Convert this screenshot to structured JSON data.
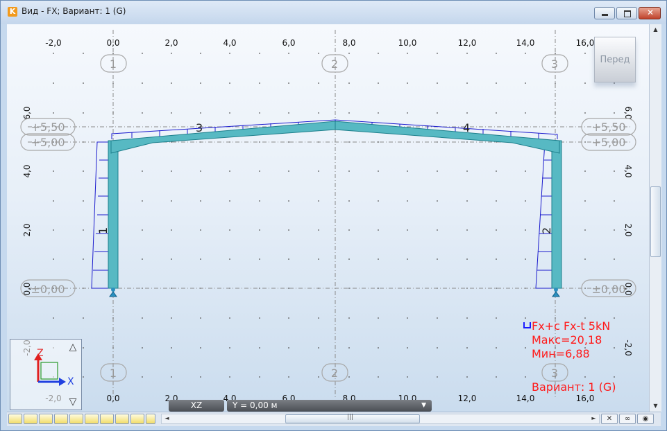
{
  "window": {
    "title": "Вид - FX; Вариант: 1 (G)",
    "app_icon": "lira-app-icon",
    "controls": [
      "minimize-icon",
      "maximize-icon",
      "close-icon"
    ]
  },
  "view_button": {
    "label": "Перед"
  },
  "ruler": {
    "x_labels": [
      "-2,0",
      "0,0",
      "2,0",
      "4,0",
      "6,0",
      "8,0",
      "10,0",
      "12,0",
      "14,0",
      "16,0"
    ],
    "y_labels": [
      "6,0",
      "4,0",
      "2,0",
      "0,0",
      "-2,0"
    ]
  },
  "axes_grid": [
    "1",
    "2",
    "3"
  ],
  "levels": [
    "+5,50",
    "+5,00",
    "±0,00"
  ],
  "elements": [
    "1",
    "2",
    "3",
    "4"
  ],
  "legend": {
    "line1": "Fx+c Fx-t  5kN",
    "max": "Макс=20,18",
    "min": "Мин=6,88",
    "variant": "Вариант: 1 (G)",
    "text_color": "#ff1a1a"
  },
  "axis_widget": {
    "z": "Z",
    "x": "X",
    "icons": [
      "view-up-icon",
      "view-down-icon"
    ]
  },
  "status": {
    "plane": "XZ",
    "coordinate": "Y = 0,00 м"
  },
  "colors": {
    "frame_fill": "#57b9c3",
    "frame_stroke": "#1d7f8c",
    "diagram": "#1a1acd",
    "grid_line": "#8a8a8a"
  }
}
